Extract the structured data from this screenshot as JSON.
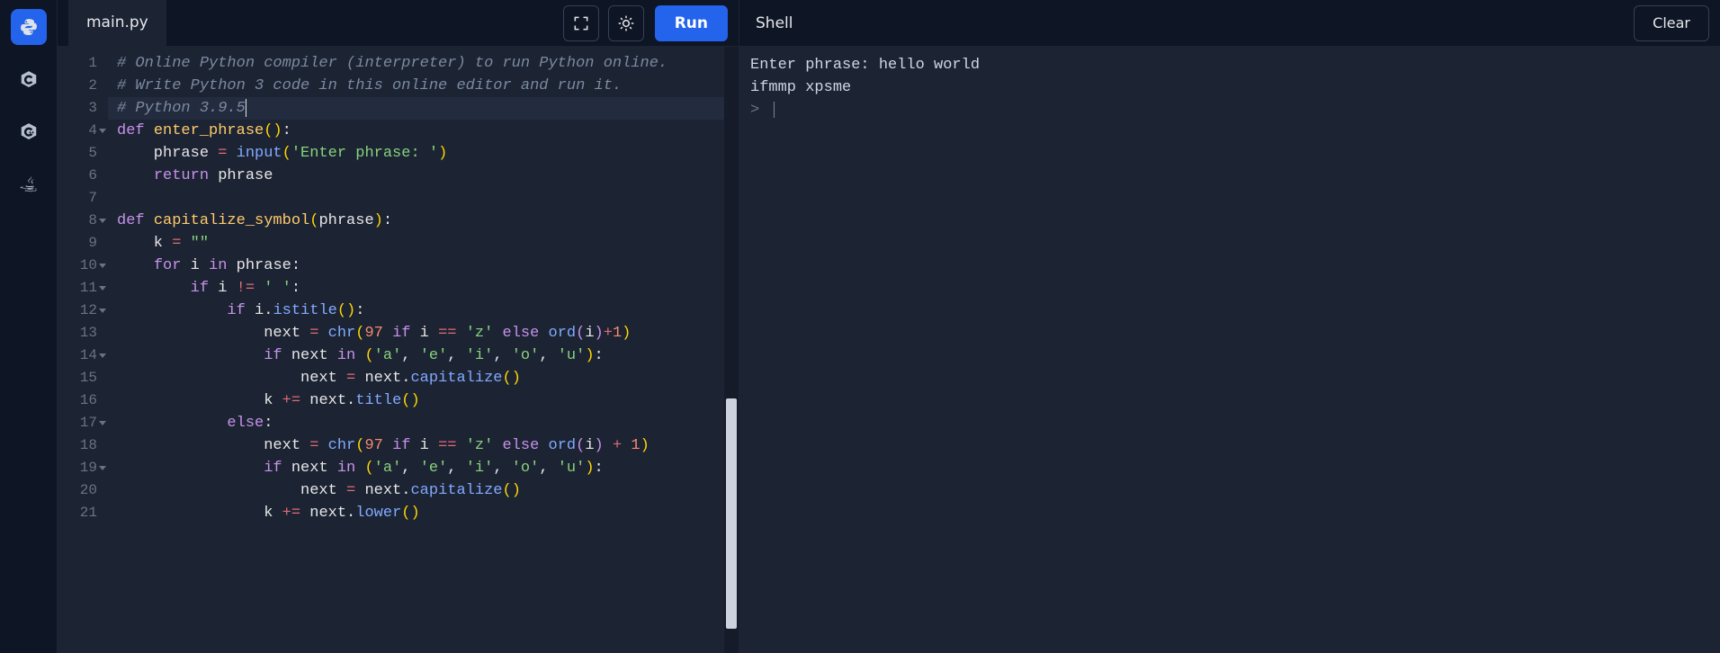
{
  "rail": {
    "items": [
      {
        "name": "python-icon",
        "active": true
      },
      {
        "name": "c-icon",
        "active": false
      },
      {
        "name": "cpp-icon",
        "active": false
      },
      {
        "name": "java-icon",
        "active": false
      }
    ]
  },
  "colors": {
    "accent": "#2463eb",
    "bg": "#0e1525",
    "panel": "#1c2333"
  },
  "editor": {
    "tab_label": "main.py",
    "run_label": "Run",
    "active_line": 3,
    "fold_lines": [
      4,
      8,
      10,
      11,
      12,
      14,
      17,
      19
    ],
    "code_lines": [
      [
        {
          "c": "cm",
          "t": "# Online Python compiler (interpreter) to run Python online."
        }
      ],
      [
        {
          "c": "cm",
          "t": "# Write Python 3 code in this online editor and run it."
        }
      ],
      [
        {
          "c": "cm",
          "t": "# Python 3.9.5"
        }
      ],
      [
        {
          "c": "kw",
          "t": "def "
        },
        {
          "c": "fn",
          "t": "enter_phrase"
        },
        {
          "c": "pn",
          "t": "()"
        },
        {
          "c": "id",
          "t": ":"
        }
      ],
      [
        {
          "c": "id",
          "t": "    phrase "
        },
        {
          "c": "op",
          "t": "="
        },
        {
          "c": "id",
          "t": " "
        },
        {
          "c": "def",
          "t": "input"
        },
        {
          "c": "pn",
          "t": "("
        },
        {
          "c": "str",
          "t": "'Enter phrase: '"
        },
        {
          "c": "pn",
          "t": ")"
        }
      ],
      [
        {
          "c": "id",
          "t": "    "
        },
        {
          "c": "kw",
          "t": "return"
        },
        {
          "c": "id",
          "t": " phrase"
        }
      ],
      [
        {
          "c": "id",
          "t": ""
        }
      ],
      [
        {
          "c": "kw",
          "t": "def "
        },
        {
          "c": "fn",
          "t": "capitalize_symbol"
        },
        {
          "c": "pn",
          "t": "("
        },
        {
          "c": "id",
          "t": "phrase"
        },
        {
          "c": "pn",
          "t": ")"
        },
        {
          "c": "id",
          "t": ":"
        }
      ],
      [
        {
          "c": "id",
          "t": "    k "
        },
        {
          "c": "op",
          "t": "="
        },
        {
          "c": "id",
          "t": " "
        },
        {
          "c": "str",
          "t": "\"\""
        }
      ],
      [
        {
          "c": "id",
          "t": "    "
        },
        {
          "c": "kw",
          "t": "for"
        },
        {
          "c": "id",
          "t": " i "
        },
        {
          "c": "kw",
          "t": "in"
        },
        {
          "c": "id",
          "t": " phrase:"
        }
      ],
      [
        {
          "c": "id",
          "t": "        "
        },
        {
          "c": "kw",
          "t": "if"
        },
        {
          "c": "id",
          "t": " i "
        },
        {
          "c": "op",
          "t": "!="
        },
        {
          "c": "id",
          "t": " "
        },
        {
          "c": "str",
          "t": "' '"
        },
        {
          "c": "id",
          "t": ":"
        }
      ],
      [
        {
          "c": "id",
          "t": "            "
        },
        {
          "c": "kw",
          "t": "if"
        },
        {
          "c": "id",
          "t": " i."
        },
        {
          "c": "def",
          "t": "istitle"
        },
        {
          "c": "pn",
          "t": "()"
        },
        {
          "c": "id",
          "t": ":"
        }
      ],
      [
        {
          "c": "id",
          "t": "                next "
        },
        {
          "c": "op",
          "t": "="
        },
        {
          "c": "id",
          "t": " "
        },
        {
          "c": "def",
          "t": "chr"
        },
        {
          "c": "pn",
          "t": "("
        },
        {
          "c": "num",
          "t": "97"
        },
        {
          "c": "id",
          "t": " "
        },
        {
          "c": "kw",
          "t": "if"
        },
        {
          "c": "id",
          "t": " i "
        },
        {
          "c": "op",
          "t": "=="
        },
        {
          "c": "id",
          "t": " "
        },
        {
          "c": "str",
          "t": "'z'"
        },
        {
          "c": "id",
          "t": " "
        },
        {
          "c": "kw",
          "t": "else"
        },
        {
          "c": "id",
          "t": " "
        },
        {
          "c": "def",
          "t": "ord"
        },
        {
          "c": "pn2",
          "t": "("
        },
        {
          "c": "id",
          "t": "i"
        },
        {
          "c": "pn2",
          "t": ")"
        },
        {
          "c": "op",
          "t": "+"
        },
        {
          "c": "num",
          "t": "1"
        },
        {
          "c": "pn",
          "t": ")"
        }
      ],
      [
        {
          "c": "id",
          "t": "                "
        },
        {
          "c": "kw",
          "t": "if"
        },
        {
          "c": "id",
          "t": " next "
        },
        {
          "c": "kw",
          "t": "in"
        },
        {
          "c": "id",
          "t": " "
        },
        {
          "c": "pn",
          "t": "("
        },
        {
          "c": "str",
          "t": "'a'"
        },
        {
          "c": "id",
          "t": ", "
        },
        {
          "c": "str",
          "t": "'e'"
        },
        {
          "c": "id",
          "t": ", "
        },
        {
          "c": "str",
          "t": "'i'"
        },
        {
          "c": "id",
          "t": ", "
        },
        {
          "c": "str",
          "t": "'o'"
        },
        {
          "c": "id",
          "t": ", "
        },
        {
          "c": "str",
          "t": "'u'"
        },
        {
          "c": "pn",
          "t": ")"
        },
        {
          "c": "id",
          "t": ":"
        }
      ],
      [
        {
          "c": "id",
          "t": "                    next "
        },
        {
          "c": "op",
          "t": "="
        },
        {
          "c": "id",
          "t": " next."
        },
        {
          "c": "def",
          "t": "capitalize"
        },
        {
          "c": "pn",
          "t": "()"
        }
      ],
      [
        {
          "c": "id",
          "t": "                k "
        },
        {
          "c": "op",
          "t": "+="
        },
        {
          "c": "id",
          "t": " next."
        },
        {
          "c": "def",
          "t": "title"
        },
        {
          "c": "pn",
          "t": "()"
        }
      ],
      [
        {
          "c": "id",
          "t": "            "
        },
        {
          "c": "kw",
          "t": "else"
        },
        {
          "c": "id",
          "t": ":"
        }
      ],
      [
        {
          "c": "id",
          "t": "                next "
        },
        {
          "c": "op",
          "t": "="
        },
        {
          "c": "id",
          "t": " "
        },
        {
          "c": "def",
          "t": "chr"
        },
        {
          "c": "pn",
          "t": "("
        },
        {
          "c": "num",
          "t": "97"
        },
        {
          "c": "id",
          "t": " "
        },
        {
          "c": "kw",
          "t": "if"
        },
        {
          "c": "id",
          "t": " i "
        },
        {
          "c": "op",
          "t": "=="
        },
        {
          "c": "id",
          "t": " "
        },
        {
          "c": "str",
          "t": "'z'"
        },
        {
          "c": "id",
          "t": " "
        },
        {
          "c": "kw",
          "t": "else"
        },
        {
          "c": "id",
          "t": " "
        },
        {
          "c": "def",
          "t": "ord"
        },
        {
          "c": "pn2",
          "t": "("
        },
        {
          "c": "id",
          "t": "i"
        },
        {
          "c": "pn2",
          "t": ")"
        },
        {
          "c": "id",
          "t": " "
        },
        {
          "c": "op",
          "t": "+"
        },
        {
          "c": "id",
          "t": " "
        },
        {
          "c": "num",
          "t": "1"
        },
        {
          "c": "pn",
          "t": ")"
        }
      ],
      [
        {
          "c": "id",
          "t": "                "
        },
        {
          "c": "kw",
          "t": "if"
        },
        {
          "c": "id",
          "t": " next "
        },
        {
          "c": "kw",
          "t": "in"
        },
        {
          "c": "id",
          "t": " "
        },
        {
          "c": "pn",
          "t": "("
        },
        {
          "c": "str",
          "t": "'a'"
        },
        {
          "c": "id",
          "t": ", "
        },
        {
          "c": "str",
          "t": "'e'"
        },
        {
          "c": "id",
          "t": ", "
        },
        {
          "c": "str",
          "t": "'i'"
        },
        {
          "c": "id",
          "t": ", "
        },
        {
          "c": "str",
          "t": "'o'"
        },
        {
          "c": "id",
          "t": ", "
        },
        {
          "c": "str",
          "t": "'u'"
        },
        {
          "c": "pn",
          "t": ")"
        },
        {
          "c": "id",
          "t": ":"
        }
      ],
      [
        {
          "c": "id",
          "t": "                    next "
        },
        {
          "c": "op",
          "t": "="
        },
        {
          "c": "id",
          "t": " next."
        },
        {
          "c": "def",
          "t": "capitalize"
        },
        {
          "c": "pn",
          "t": "()"
        }
      ],
      [
        {
          "c": "id",
          "t": "                k "
        },
        {
          "c": "op",
          "t": "+="
        },
        {
          "c": "id",
          "t": " next."
        },
        {
          "c": "def",
          "t": "lower"
        },
        {
          "c": "pn",
          "t": "()"
        }
      ]
    ]
  },
  "shell": {
    "title": "Shell",
    "clear_label": "Clear",
    "output": [
      "Enter phrase: hello world",
      "ifmmp xpsme"
    ],
    "prompt": ">"
  }
}
